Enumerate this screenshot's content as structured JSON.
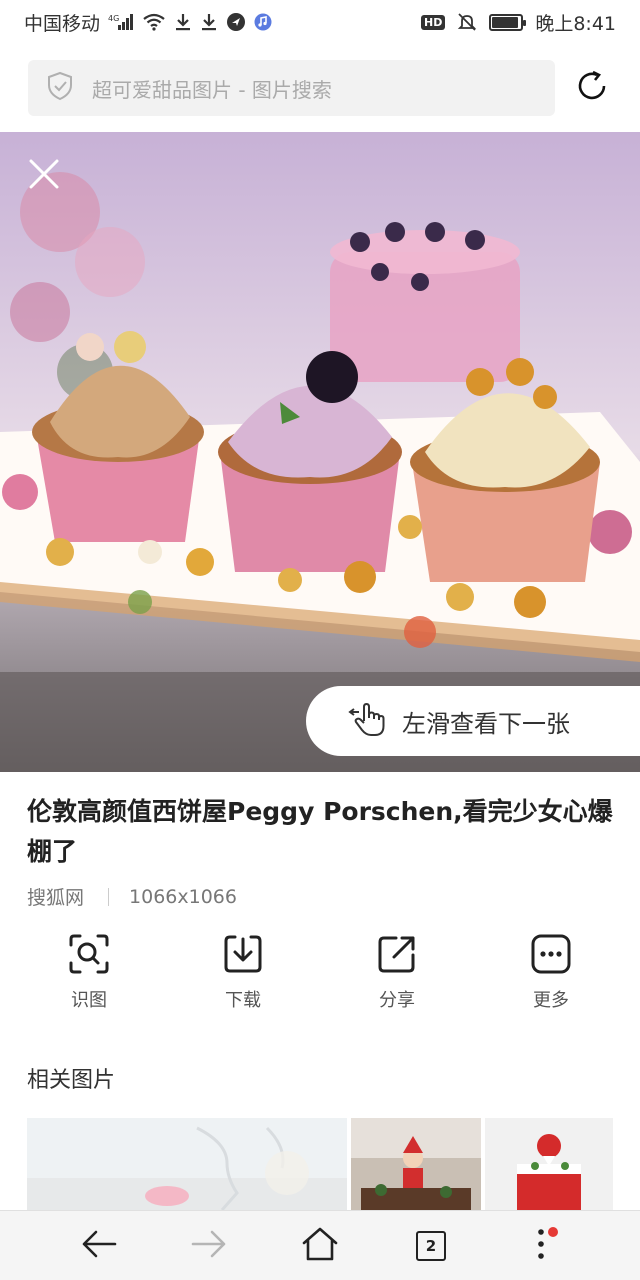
{
  "status_bar": {
    "carrier": "中国移动",
    "network": "4G",
    "hd_badge": "HD",
    "battery_level": 0.9,
    "time": "晚上8:41"
  },
  "search": {
    "placeholder": "超可爱甜品图片 - 图片搜索"
  },
  "viewer": {
    "swipe_hint": "左滑查看下一张",
    "title": "伦敦高颜值西饼屋Peggy Porschen,看完少女心爆棚了",
    "source": "搜狐网",
    "dimensions": "1066x1066"
  },
  "actions": [
    {
      "label": "识图",
      "icon": "image-search-icon"
    },
    {
      "label": "下载",
      "icon": "download-icon"
    },
    {
      "label": "分享",
      "icon": "share-icon"
    },
    {
      "label": "更多",
      "icon": "more-icon"
    }
  ],
  "related": {
    "title": "相关图片"
  },
  "bottom_nav": {
    "tab_count": "2"
  },
  "colors": {
    "accent_red": "#e53935",
    "icon_dark": "#222222"
  }
}
